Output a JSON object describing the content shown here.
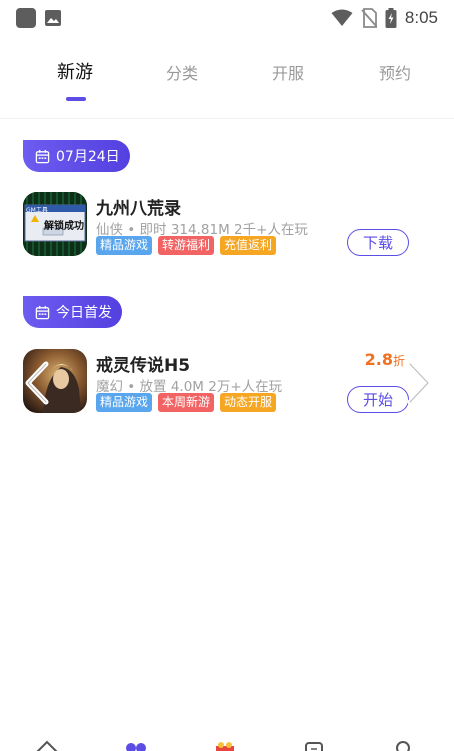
{
  "status_bar": {
    "time": "8:05",
    "icons": [
      "app-square-icon",
      "image-icon",
      "wifi-icon",
      "no-sim-icon",
      "battery-icon"
    ]
  },
  "tabs": [
    {
      "label": "新游",
      "active": true
    },
    {
      "label": "分类",
      "active": false
    },
    {
      "label": "开服",
      "active": false
    },
    {
      "label": "预约",
      "active": false
    }
  ],
  "sections": [
    {
      "date_label": "07月24日",
      "games": [
        {
          "name": "九州八荒录",
          "meta": "仙侠 • 即时   314.81M  2千+人在玩",
          "tags": [
            "精品游戏",
            "转游福利",
            "充值返利"
          ],
          "button": "下载",
          "icon_text": "解锁成功",
          "icon_caption": "GM工具"
        }
      ]
    },
    {
      "date_label": "今日首发",
      "games": [
        {
          "name": "戒灵传说H5",
          "meta": "魔幻 • 放置   4.0M  2万+人在玩",
          "tags": [
            "本周新游",
            "动态开服"
          ],
          "first_tag": "精品游戏",
          "button": "开始",
          "discount_value": "2.8",
          "discount_unit": "折"
        }
      ]
    }
  ],
  "colors": {
    "accent": "#5b4de6",
    "tag_blue": "#59a6ee",
    "tag_red": "#f26464",
    "tag_orange": "#f5a623",
    "discount": "#f07020"
  }
}
